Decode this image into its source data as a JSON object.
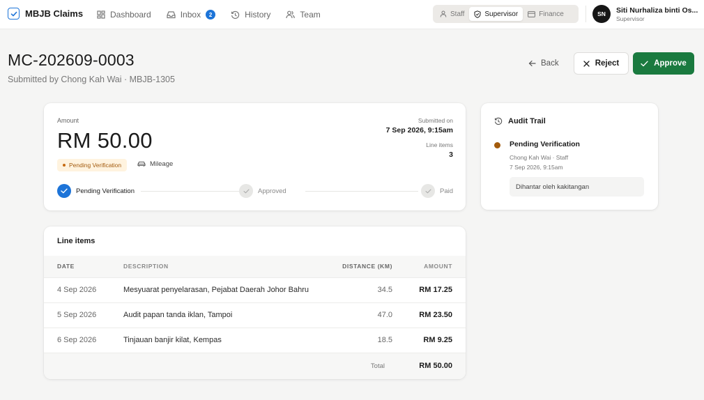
{
  "nav": {
    "brand": "MBJB Claims",
    "links": [
      {
        "label": "Dashboard",
        "icon": "dashboard-grid-icon"
      },
      {
        "label": "Inbox",
        "icon": "inbox-tray-icon",
        "badge": "2"
      },
      {
        "label": "History",
        "icon": "history-clock-icon"
      },
      {
        "label": "Team",
        "icon": "team-people-icon"
      }
    ],
    "roles": [
      {
        "label": "Staff",
        "icon": "person-icon",
        "active": false
      },
      {
        "label": "Supervisor",
        "icon": "shield-check-icon",
        "active": true
      },
      {
        "label": "Finance",
        "icon": "card-icon",
        "active": false
      }
    ],
    "user": {
      "initials": "SN",
      "name": "Siti Nurhaliza binti Os...",
      "role": "Supervisor"
    }
  },
  "header": {
    "claim_id": "MC-202609-0003",
    "subtitle": "Submitted by Chong Kah Wai · MBJB-1305",
    "back_label": "Back",
    "reject_label": "Reject",
    "approve_label": "Approve"
  },
  "summary": {
    "amount_label": "Amount",
    "amount": "RM 50.00",
    "status": "Pending Verification",
    "category": "Mileage",
    "submitted_label": "Submitted on",
    "submitted_value": "7 Sep 2026, 9:15am",
    "line_items_label": "Line items",
    "line_items_count": "3",
    "steps": [
      {
        "label": "Pending Verification",
        "state": "done"
      },
      {
        "label": "Approved",
        "state": "todo"
      },
      {
        "label": "Paid",
        "state": "todo"
      }
    ]
  },
  "audit": {
    "title": "Audit Trail",
    "entry": {
      "status": "Pending Verification",
      "actor": "Chong Kah Wai · Staff",
      "time": "7 Sep 2026, 9:15am",
      "note": "Dihantar oleh kakitangan"
    }
  },
  "line_items": {
    "title": "Line items",
    "columns": [
      "DATE",
      "DESCRIPTION",
      "DISTANCE (KM)",
      "AMOUNT"
    ],
    "rows": [
      {
        "date": "4 Sep 2026",
        "description": "Mesyuarat penyelarasan, Pejabat Daerah Johor Bahru",
        "distance": "34.5",
        "amount": "RM 17.25"
      },
      {
        "date": "5 Sep 2026",
        "description": "Audit papan tanda iklan, Tampoi",
        "distance": "47.0",
        "amount": "RM 23.50"
      },
      {
        "date": "6 Sep 2026",
        "description": "Tinjauan banjir kilat, Kempas",
        "distance": "18.5",
        "amount": "RM 9.25"
      }
    ],
    "total_label": "Total",
    "total_value": "RM 50.00"
  },
  "colors": {
    "accent": "#1d74d8",
    "approve": "#1a7a3f",
    "pending": "#a35b0c",
    "pending_bg": "#fff3df"
  }
}
